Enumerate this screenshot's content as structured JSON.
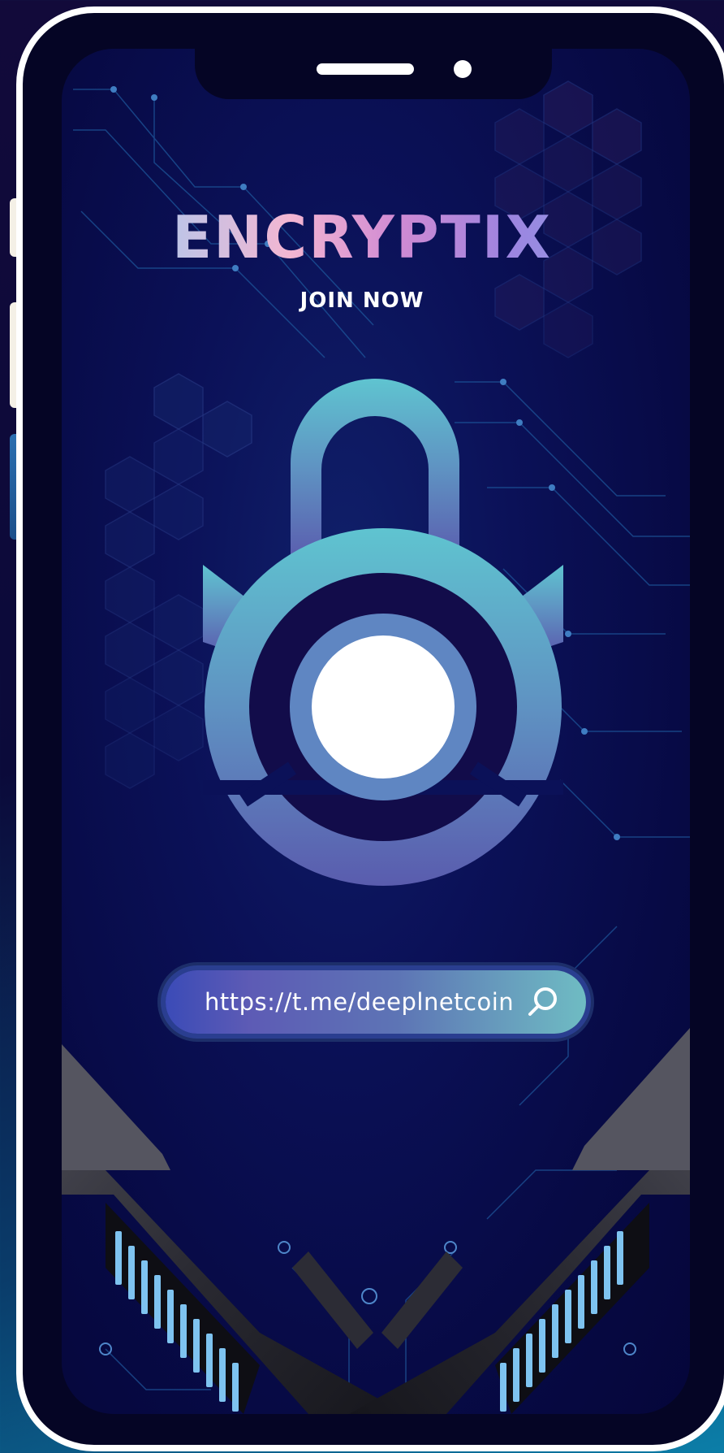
{
  "brand": {
    "name": "ENCRYPTIX",
    "tagline": "JOIN NOW"
  },
  "search": {
    "value": "https://t.me/deeplnetcoin",
    "icon": "search-icon"
  },
  "colors": {
    "accent": "#5bbfcf",
    "lock_gradient_top": "#5fc2d0",
    "lock_gradient_bottom": "#5a5fb0",
    "screen_background": "#0b1158",
    "frame": "#ffffff"
  },
  "icons": {
    "lock": "padlock-icon",
    "search": "search-icon"
  }
}
